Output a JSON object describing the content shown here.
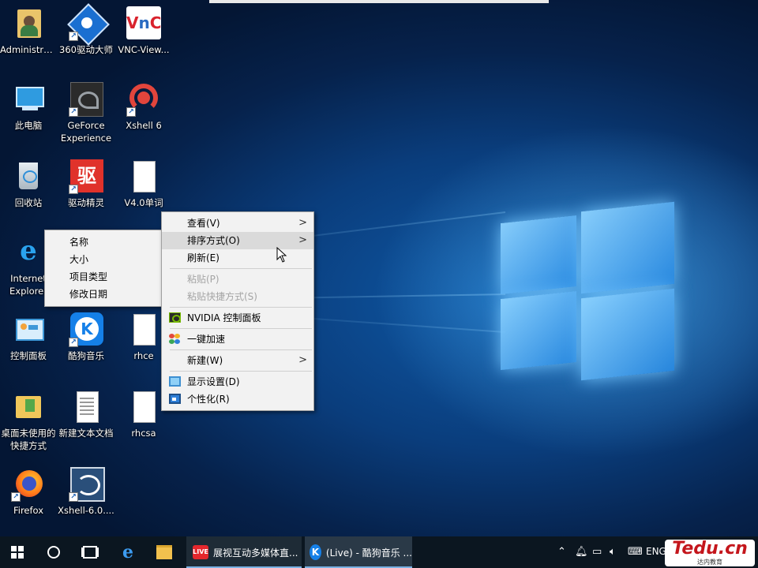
{
  "desktop": {
    "icons": [
      {
        "label": "Administra...",
        "icon": "user-folder-icon"
      },
      {
        "label": "360驱动大师",
        "icon": "360-driver-icon"
      },
      {
        "label": "VNC-View...",
        "icon": "vnc-viewer-icon"
      },
      {
        "label": "此电脑",
        "icon": "this-pc-icon"
      },
      {
        "label": "GeForce Experience",
        "icon": "geforce-icon"
      },
      {
        "label": "Xshell 6",
        "icon": "xshell-icon"
      },
      {
        "label": "回收站",
        "icon": "recycle-bin-icon"
      },
      {
        "label": "驱动精灵",
        "icon": "driver-genius-icon"
      },
      {
        "label": "V4.0单词",
        "icon": "document-icon"
      },
      {
        "label": "Internet Explorer",
        "icon": "internet-explorer-icon"
      },
      {
        "label": "控制面板",
        "icon": "control-panel-icon"
      },
      {
        "label": "酷狗音乐",
        "icon": "kugou-icon"
      },
      {
        "label": "rhce",
        "icon": "document-icon"
      },
      {
        "label": "桌面未使用的快捷方式",
        "icon": "folder-icon"
      },
      {
        "label": "新建文本文档",
        "icon": "text-document-icon"
      },
      {
        "label": "rhcsa",
        "icon": "document-icon"
      },
      {
        "label": "Firefox",
        "icon": "firefox-icon"
      },
      {
        "label": "Xshell-6.0....",
        "icon": "xshell-installer-icon"
      }
    ]
  },
  "context_menu": {
    "items": [
      {
        "label": "查看(V)",
        "submenu": true
      },
      {
        "label": "排序方式(O)",
        "submenu": true,
        "highlighted": true
      },
      {
        "label": "刷新(E)"
      },
      {
        "label": "粘贴(P)",
        "disabled": true
      },
      {
        "label": "粘贴快捷方式(S)",
        "disabled": true
      },
      {
        "label": "NVIDIA 控制面板",
        "icon": "nvidia-icon"
      },
      {
        "label": "一键加速",
        "icon": "speedup-icon"
      },
      {
        "label": "新建(W)",
        "submenu": true
      },
      {
        "label": "显示设置(D)",
        "icon": "display-settings-icon"
      },
      {
        "label": "个性化(R)",
        "icon": "personalize-icon"
      }
    ]
  },
  "sort_submenu": {
    "items": [
      "名称",
      "大小",
      "项目类型",
      "修改日期"
    ]
  },
  "taskbar": {
    "apps": [
      {
        "label": "展视互动多媒体直...",
        "icon": "live-app-icon"
      },
      {
        "label": "(Live) - 酷狗音乐 ...",
        "icon": "kugou-icon"
      }
    ],
    "language": "ENG"
  },
  "watermark": {
    "text": "Tedu.cn",
    "subtext": "达内教育"
  },
  "colors": {
    "accent": "#7ab1e3",
    "menu_bg": "#f2f2f2",
    "menu_highlight": "#dadada",
    "taskbar": "#0b1620"
  }
}
